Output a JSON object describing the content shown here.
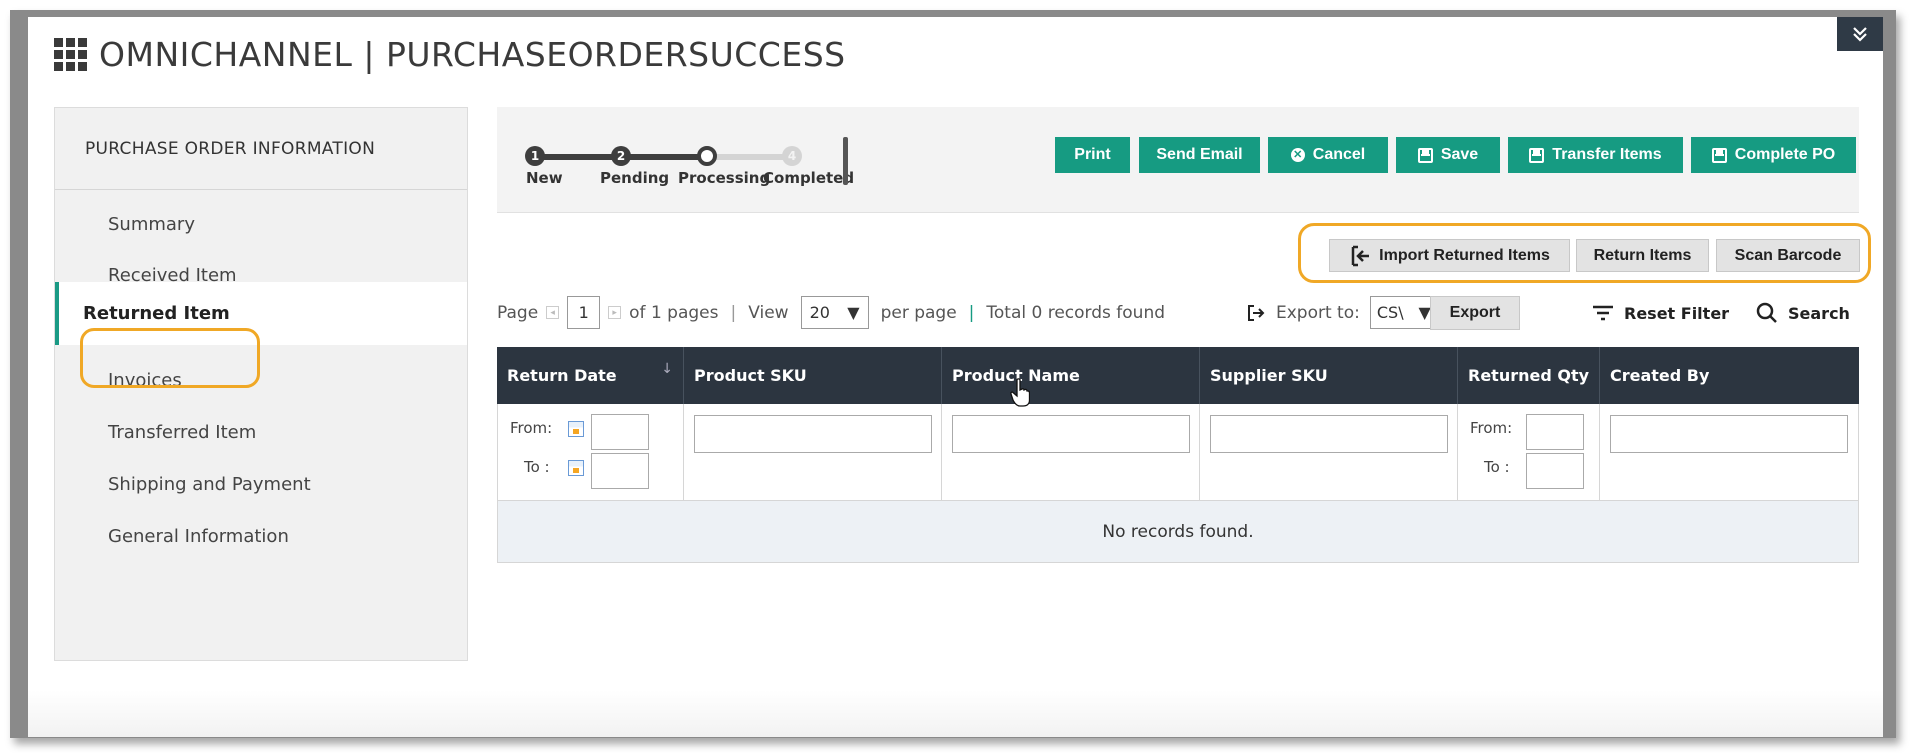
{
  "page": {
    "title": "OMNICHANNEL | PURCHASEORDERSUCCESS"
  },
  "sidebar": {
    "header": "PURCHASE ORDER INFORMATION",
    "items": [
      {
        "label": "Summary"
      },
      {
        "label": "Received Item"
      },
      {
        "label": "Returned Item",
        "active": true
      },
      {
        "label": "Invoices"
      },
      {
        "label": "Transferred Item"
      },
      {
        "label": "Shipping and Payment"
      },
      {
        "label": "General Information"
      }
    ]
  },
  "progress": {
    "steps": [
      {
        "number": "1",
        "label": "New",
        "state": "done"
      },
      {
        "number": "2",
        "label": "Pending",
        "state": "done"
      },
      {
        "number": "",
        "label": "Processing",
        "state": "current"
      },
      {
        "number": "4",
        "label": "Completed",
        "state": "todo"
      }
    ]
  },
  "toolbar": {
    "print": "Print",
    "send_email": "Send Email",
    "cancel": "Cancel",
    "save": "Save",
    "transfer_items": "Transfer Items",
    "complete_po": "Complete PO"
  },
  "actions": {
    "import_returned": "Import Returned Items",
    "return_items": "Return Items",
    "scan_barcode": "Scan Barcode"
  },
  "pager": {
    "page_label": "Page",
    "page_value": "1",
    "of_pages": "of 1 pages",
    "view_label": "View",
    "per_page_value": "20",
    "per_page_label": "per page",
    "total": "Total 0 records found"
  },
  "export": {
    "label": "Export to:",
    "format_value": "CS\\",
    "button": "Export"
  },
  "tools": {
    "reset_filter": "Reset Filter",
    "search": "Search"
  },
  "table": {
    "columns": [
      "Return Date",
      "Product SKU",
      "Product Name",
      "Supplier SKU",
      "Returned Qty",
      "Created By"
    ],
    "filter_from": "From:",
    "filter_to": "To :",
    "empty_message": "No records found."
  },
  "colors": {
    "accent": "#169b82",
    "header_dark": "#2c3540",
    "highlight": "#f0a826"
  }
}
